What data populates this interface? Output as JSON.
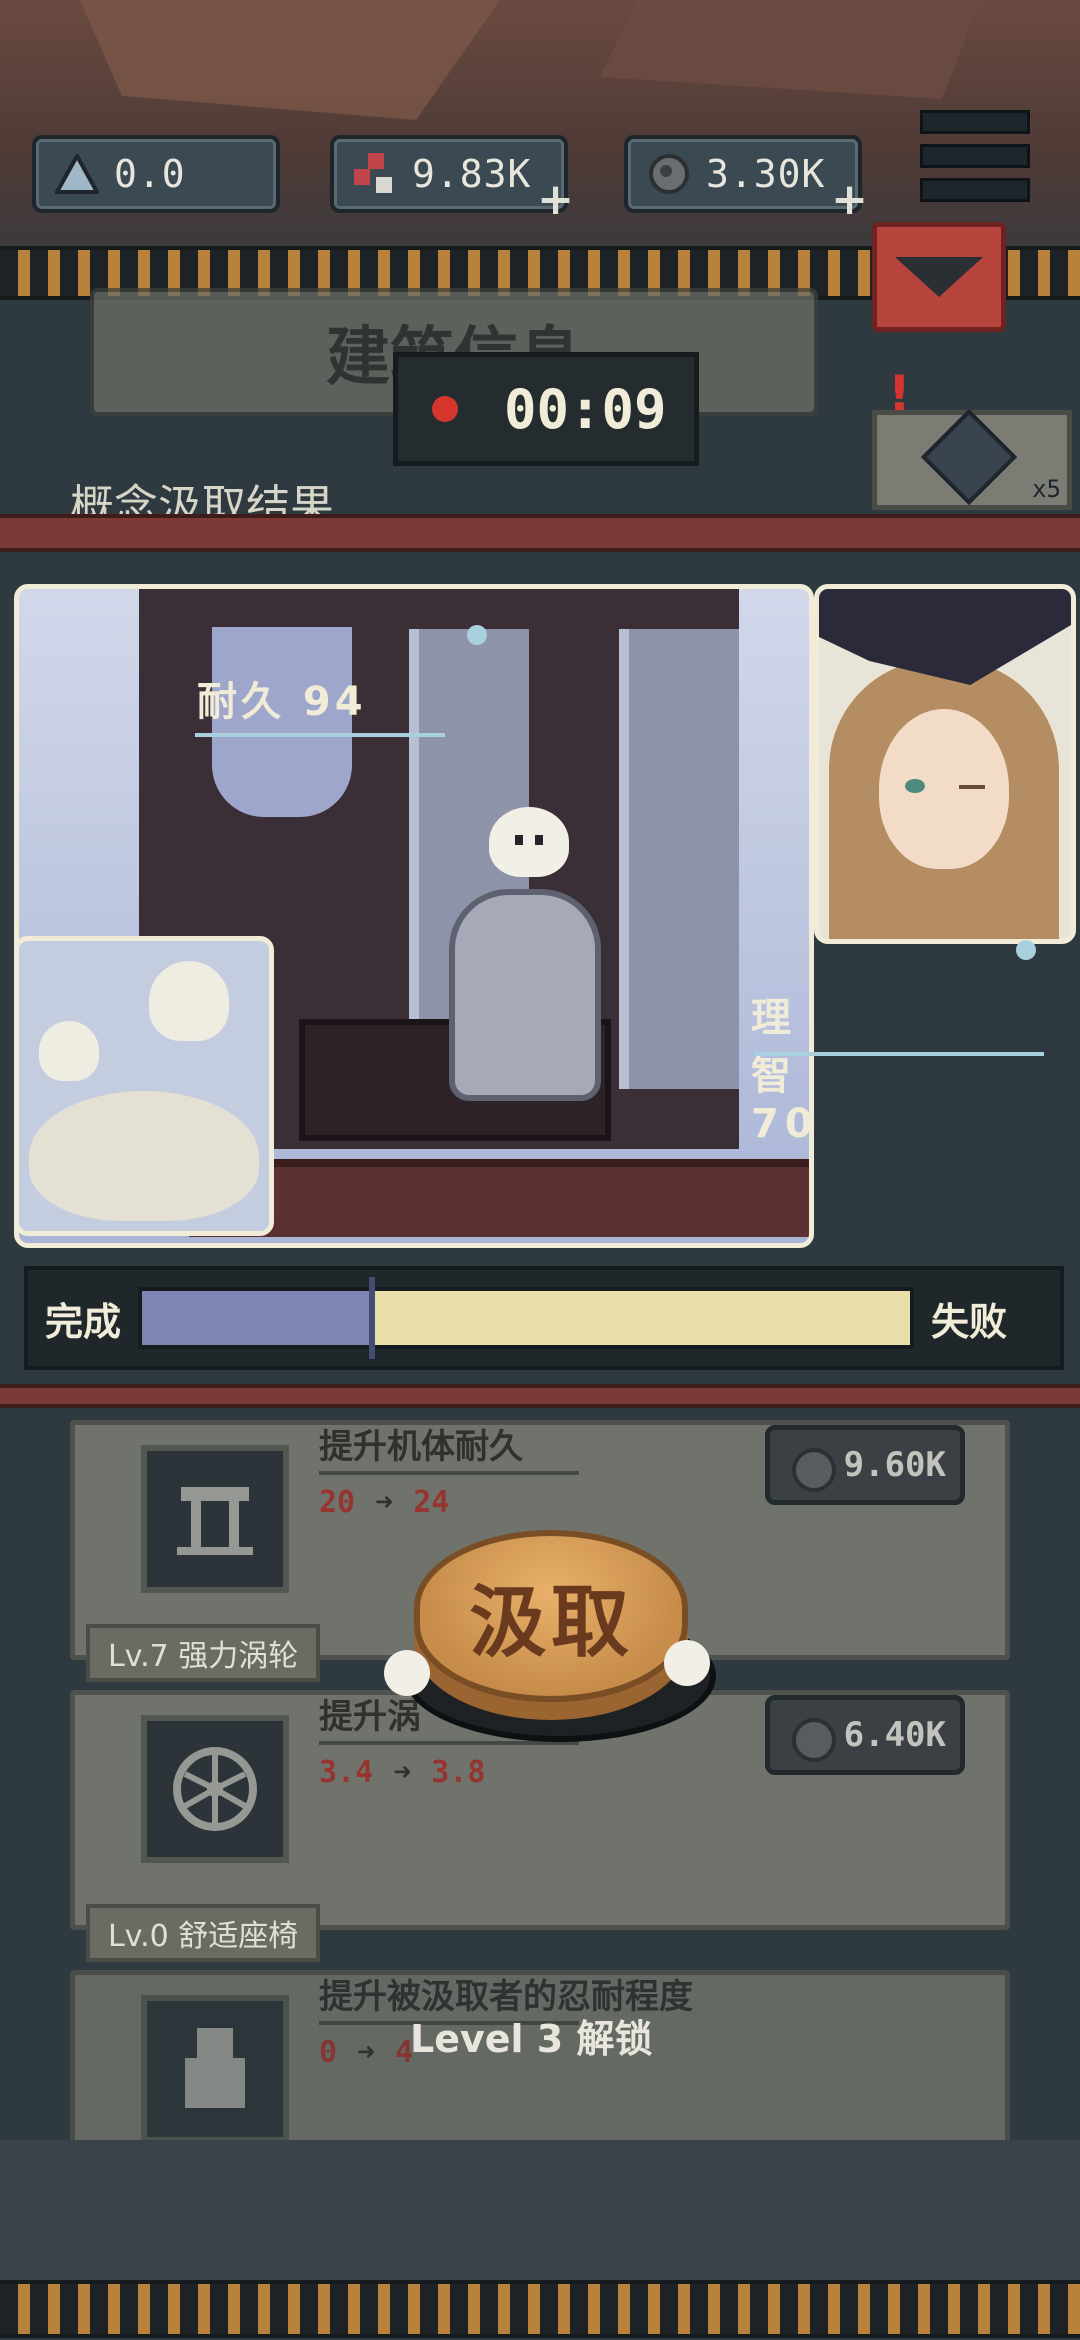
{
  "resources": [
    {
      "icon": "triangle-crystal-icon",
      "value": "0.0",
      "has_plus": false
    },
    {
      "icon": "red-gems-icon",
      "value": "9.83K",
      "has_plus": true
    },
    {
      "icon": "ore-coin-icon",
      "value": "3.30K",
      "has_plus": true
    }
  ],
  "building": {
    "title": "建筑信息",
    "subtitle": "概念汲取结果"
  },
  "timer": "00:09",
  "crystal_item": {
    "count": "x5"
  },
  "scene": {
    "durability_label": "耐久 94",
    "sanity_label": "理智 70"
  },
  "progress": {
    "left_label": "完成",
    "right_label": "失败",
    "fill_fraction": 0.3
  },
  "upgrades": [
    {
      "level_tag": "",
      "title": "提升机体耐久",
      "from": "20",
      "to": "24",
      "price": "9.60K",
      "icon": "pedestal-icon"
    },
    {
      "level_tag": "Lv.7 强力涡轮",
      "title": "提升涡",
      "from": "3.4",
      "to": "3.8",
      "price": "6.40K",
      "icon": "turbine-icon"
    },
    {
      "level_tag": "Lv.0 舒适座椅",
      "title": "提升被汲取者的忍耐程度",
      "from": "0",
      "to": "4",
      "price": "",
      "icon": "seat-icon"
    }
  ],
  "extract_button": "汲取",
  "lock_text": "Level 3 解锁",
  "colors": {
    "accent_red": "#d6352e",
    "progress_blue": "#7f86b4",
    "progress_cream": "#e8dfaa",
    "button_orange": "#c78c4a"
  }
}
